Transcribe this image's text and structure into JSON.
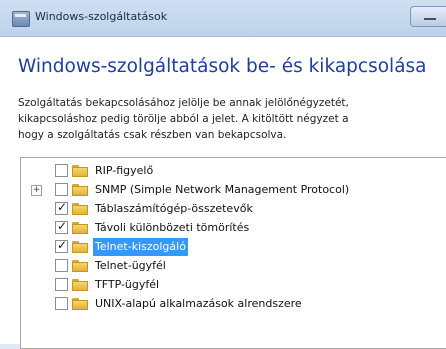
{
  "window": {
    "title": "Windows-szolgáltatások",
    "heading": "Windows-szolgáltatások be- és kikapcsolása",
    "description_lines": [
      "Szolgáltatás bekapcsolásához jelölje be annak jelölőnégyzetét,",
      "kikapcsoláshoz pedig törölje abból a jelet. A kitöltött négyzet a",
      "hogy a szolgáltatás csak részben van bekapcsolva."
    ]
  },
  "features": [
    {
      "label": "RIP-figyelő",
      "checked": false,
      "expandable": false,
      "selected": false
    },
    {
      "label": "SNMP (Simple Network Management Protocol)",
      "checked": false,
      "expandable": true,
      "selected": false
    },
    {
      "label": "Táblaszámítógép-összetevők",
      "checked": true,
      "expandable": false,
      "selected": false
    },
    {
      "label": "Távoli különbözeti tömörítés",
      "checked": true,
      "expandable": false,
      "selected": false
    },
    {
      "label": "Telnet-kiszolgáló",
      "checked": true,
      "expandable": false,
      "selected": true
    },
    {
      "label": "Telnet-ügyfél",
      "checked": false,
      "expandable": false,
      "selected": false
    },
    {
      "label": "TFTP-ügyfél",
      "checked": false,
      "expandable": false,
      "selected": false
    },
    {
      "label": "UNIX-alapú alkalmazások alrendszere",
      "checked": false,
      "expandable": false,
      "selected": false
    }
  ],
  "icons": {
    "title": "window-icon",
    "folder": "folder-icon",
    "expander_glyph": "+"
  }
}
